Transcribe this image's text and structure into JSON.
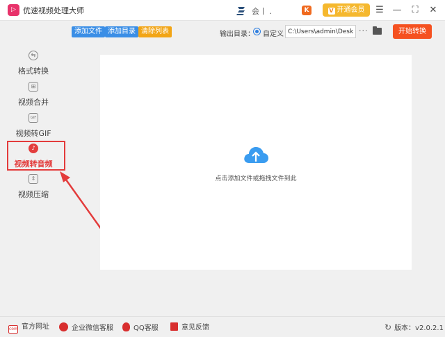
{
  "titlebar": {
    "app_title": "优速视频处理大师",
    "user_name": "会丨 .",
    "user_badge": "K",
    "vip_icon": "V",
    "vip_label": "开通会员",
    "menu_icon": "☰",
    "minimize_icon": "—",
    "maximize_icon": "⛶",
    "close_icon": "✕"
  },
  "sidebar": {
    "items": [
      {
        "label": "格式转换",
        "icon": "format-convert-icon",
        "glyph": "⇆"
      },
      {
        "label": "视频合并",
        "icon": "video-merge-icon",
        "glyph": "⊞"
      },
      {
        "label": "视频转GIF",
        "icon": "video-gif-icon",
        "glyph": "GIF"
      },
      {
        "label": "视频转音频",
        "icon": "video-audio-icon",
        "glyph": "♪"
      },
      {
        "label": "视频压缩",
        "icon": "video-compress-icon",
        "glyph": "⇕"
      }
    ],
    "active_index": 3
  },
  "toolbar": {
    "add_file": "添加文件",
    "add_dir": "添加目录",
    "clear_list": "清除列表",
    "output_label": "输出目录：",
    "custom_label": "自定义",
    "path_value": "C:\\Users\\admin\\Deskto",
    "more_label": "···",
    "start_label": "开始转换"
  },
  "drop_area": {
    "hint": "点击添加文件或拖拽文件到此"
  },
  "footer": {
    "website": "官方网址",
    "wechat": "企业微信客服",
    "qq": "QQ客服",
    "feedback": "意见反馈",
    "version": "版本：v2.0.2.1",
    "web_icon_text": "com",
    "refresh_icon": "↻"
  },
  "colors": {
    "accent_red": "#e33d3d",
    "button_blue": "#3a8ee6",
    "button_orange": "#f2a516",
    "start_orange": "#f55120",
    "vip_gold": "#f5b82e",
    "cloud_blue": "#3a9cf0"
  }
}
